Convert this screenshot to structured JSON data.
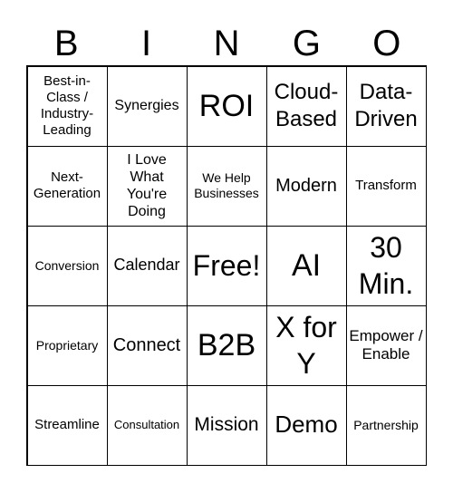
{
  "header": [
    "B",
    "I",
    "N",
    "G",
    "O"
  ],
  "cells": [
    "Best-in-Class / Industry-Leading",
    "Synergies",
    "ROI",
    "Cloud-Based",
    "Data-Driven",
    "Next-Generation",
    "I Love What You're Doing",
    "We Help Businesses",
    "Modern",
    "Transform",
    "Conversion",
    "Calendar",
    "Free!",
    "AI",
    "30 Min.",
    "Proprietary",
    "Connect",
    "B2B",
    "X for Y",
    "Empower / Enable",
    "Streamline",
    "Consultation",
    "Mission",
    "Demo",
    "Partnership"
  ]
}
